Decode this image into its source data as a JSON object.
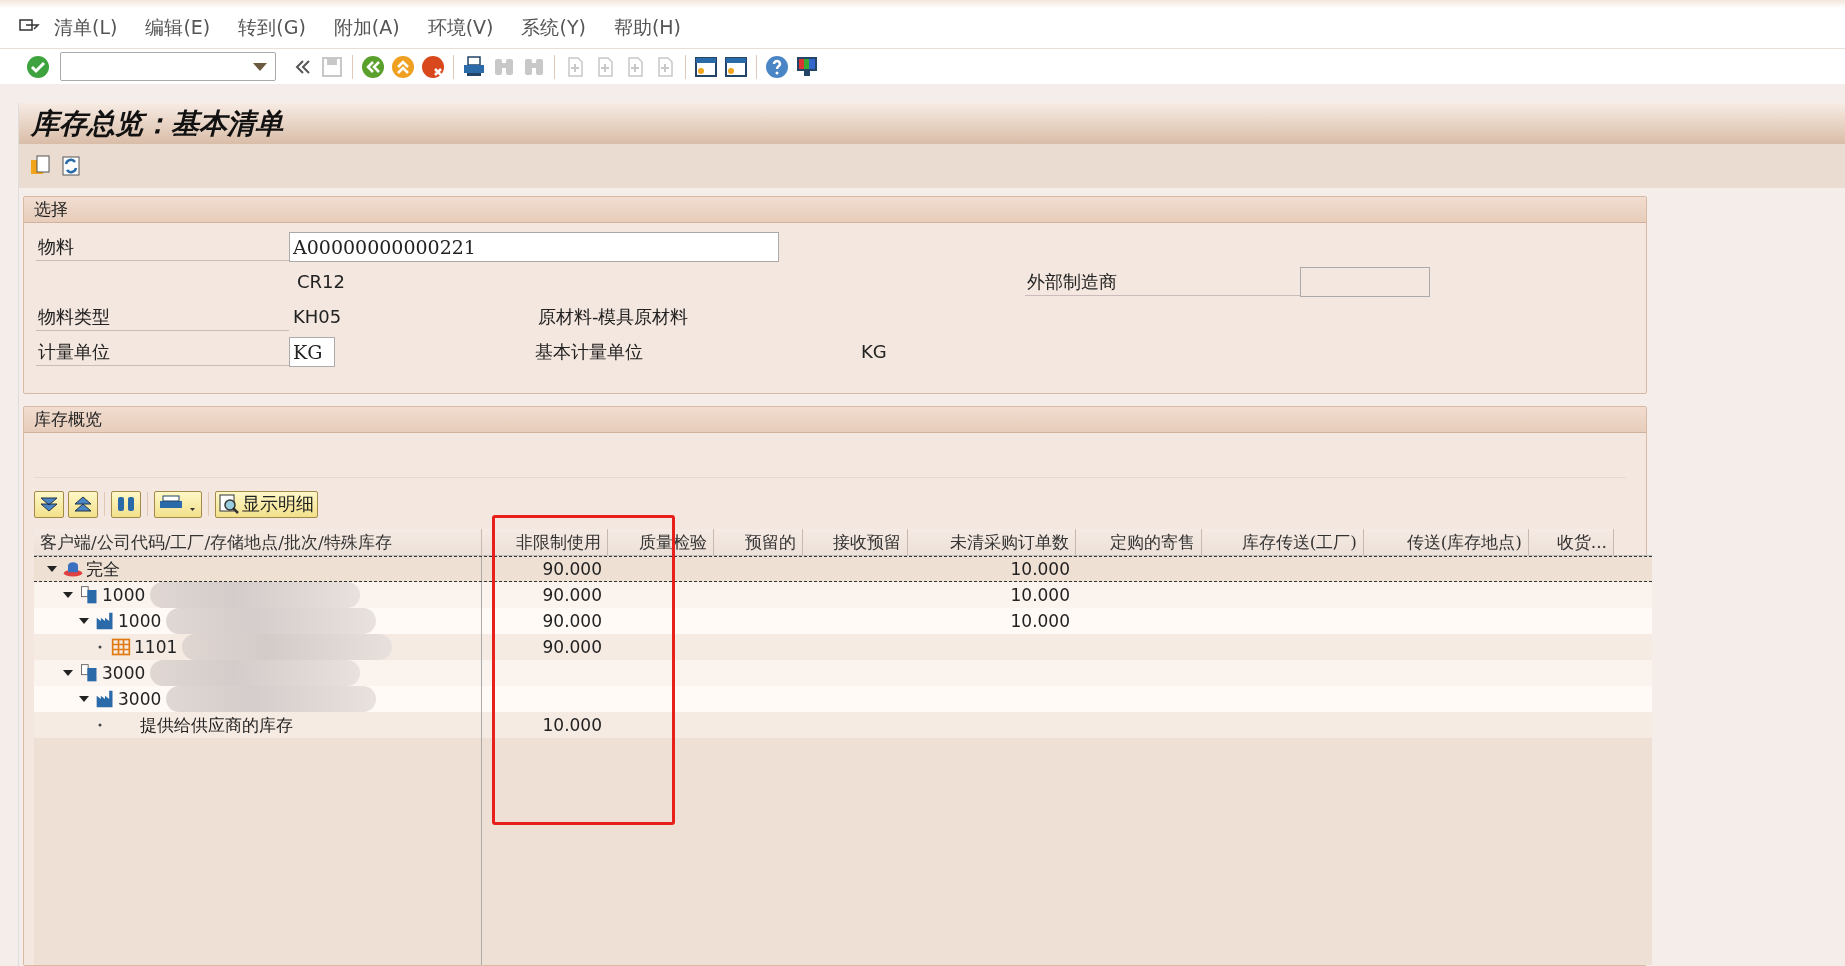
{
  "menu": [
    {
      "label": "清单(L)"
    },
    {
      "label": "编辑(E)"
    },
    {
      "label": "转到(G)"
    },
    {
      "label": "附加(A)"
    },
    {
      "label": "环境(V)"
    },
    {
      "label": "系统(Y)"
    },
    {
      "label": "帮助(H)"
    }
  ],
  "toolbar": [
    {
      "kind": "enter",
      "disabled": false
    },
    {
      "kind": "command-field",
      "disabled": false
    },
    {
      "kind": "collapse",
      "disabled": false
    },
    {
      "kind": "save",
      "disabled": true
    },
    {
      "kind": "separator"
    },
    {
      "kind": "back",
      "disabled": false
    },
    {
      "kind": "exit",
      "disabled": false
    },
    {
      "kind": "cancel",
      "disabled": false
    },
    {
      "kind": "separator"
    },
    {
      "kind": "print",
      "disabled": false
    },
    {
      "kind": "find",
      "disabled": true
    },
    {
      "kind": "find",
      "disabled": true
    },
    {
      "kind": "separator"
    },
    {
      "kind": "page",
      "disabled": true
    },
    {
      "kind": "page",
      "disabled": true
    },
    {
      "kind": "page",
      "disabled": true
    },
    {
      "kind": "page",
      "disabled": true
    },
    {
      "kind": "separator"
    },
    {
      "kind": "window",
      "disabled": false
    },
    {
      "kind": "window",
      "disabled": false
    },
    {
      "kind": "separator"
    },
    {
      "kind": "help",
      "disabled": false
    },
    {
      "kind": "monitor",
      "disabled": false
    }
  ],
  "title": "库存总览：基本清单",
  "selection": {
    "title": "选择",
    "material_label": "物料",
    "material_value": "A00000000000221",
    "description": "CR12",
    "manufacturer_label": "外部制造商",
    "material_type_label": "物料类型",
    "material_type": "KH05",
    "material_type_text": "原材料-模具原材料",
    "unit_label": "计量单位",
    "unit_value": "KG",
    "base_unit_label": "基本计量单位",
    "base_unit": "KG"
  },
  "overview": {
    "title": "库存概览",
    "detail_button": "显示明细",
    "columns": [
      "客户端/公司代码/工厂/存储地点/批次/特殊库存",
      "非限制使用",
      "质量检验",
      "预留的",
      "接收预留",
      "未清采购订单数",
      "定购的寄售",
      "库存传送(工厂)",
      "传送(库存地点)",
      "收货..."
    ],
    "tree": [
      {
        "label": "完全",
        "kind": "total",
        "expanded": true,
        "selected": true,
        "masked": false,
        "unrestricted_use": "90.000",
        "open_purchase_orders": "10.000",
        "children": [
          {
            "label": "1000",
            "kind": "company",
            "expanded": true,
            "selected": false,
            "masked": true,
            "unrestricted_use": "90.000",
            "open_purchase_orders": "10.000",
            "children": [
              {
                "label": "1000",
                "kind": "plant",
                "expanded": true,
                "selected": false,
                "masked": true,
                "unrestricted_use": "90.000",
                "open_purchase_orders": "10.000",
                "children": [
                  {
                    "label": "1101",
                    "kind": "storage",
                    "selected": false,
                    "masked": true,
                    "unrestricted_use": "90.000"
                  }
                ]
              }
            ]
          },
          {
            "label": "3000",
            "kind": "company",
            "expanded": true,
            "selected": false,
            "masked": true,
            "children": [
              {
                "label": "3000",
                "kind": "plant",
                "expanded": true,
                "selected": false,
                "masked": true,
                "children": [
                  {
                    "label": "提供给供应商的库存",
                    "kind": "special",
                    "selected": false,
                    "masked": false,
                    "unrestricted_use": "10.000"
                  }
                ]
              }
            ]
          }
        ]
      }
    ]
  }
}
